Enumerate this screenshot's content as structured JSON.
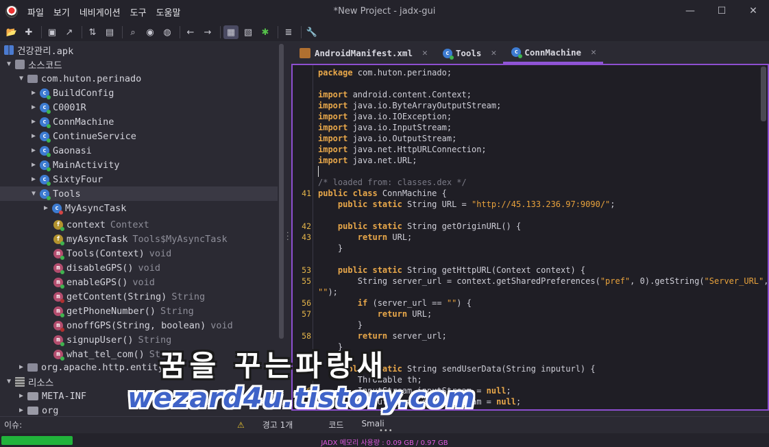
{
  "window": {
    "title": "*New Project - jadx-gui",
    "minimize": "—",
    "maximize": "☐",
    "close": "✕"
  },
  "menu": [
    "파일",
    "보기",
    "네비게이션",
    "도구",
    "도움말"
  ],
  "toolbar": {
    "icons": [
      "open-file-icon",
      "add-file-icon",
      "save-icon",
      "export-icon",
      "sync-icon",
      "flatten-packages-icon",
      "search-icon",
      "find-usage-icon",
      "deobfuscation-icon",
      "back-icon",
      "forward-icon",
      "quark-icon",
      "logcat-icon",
      "debug-icon",
      "log-icon",
      "preferences-icon"
    ]
  },
  "tree": {
    "apk": "건강관리.apk",
    "source_root": "소스코드",
    "package": "com.huton.perinado",
    "classes": [
      "BuildConfig",
      "C0001R",
      "ConnMachine",
      "ContinueService",
      "Gaonasi",
      "MainActivity",
      "SixtyFour",
      "Tools"
    ],
    "tools_children": {
      "inner_class": "MyAsyncTask",
      "fields": [
        {
          "name": "context",
          "type": "Context"
        },
        {
          "name": "myAsyncTask",
          "type": "Tools$MyAsyncTask"
        }
      ],
      "methods": [
        {
          "name": "Tools(Context)",
          "type": "void"
        },
        {
          "name": "disableGPS()",
          "type": "void"
        },
        {
          "name": "enableGPS()",
          "type": "void"
        },
        {
          "name": "getContent(String)",
          "type": "String"
        },
        {
          "name": "getPhoneNumber()",
          "type": "String"
        },
        {
          "name": "onoffGPS(String, boolean)",
          "type": "void"
        },
        {
          "name": "signupUser()",
          "type": "String"
        },
        {
          "name": "what_tel_com()",
          "type": "String"
        }
      ]
    },
    "other_package": "org.apache.http.entity",
    "resources_root": "리소스",
    "resources": [
      "META-INF",
      "org"
    ]
  },
  "tabs": [
    {
      "label": "AndroidManifest.xml",
      "icon": "xml-file-icon"
    },
    {
      "label": "Tools",
      "icon": "class-icon"
    },
    {
      "label": "ConnMachine",
      "icon": "class-icon",
      "active": true
    }
  ],
  "code": {
    "lines": [
      {
        "ln": "",
        "segs": [
          [
            "kw",
            "package"
          ],
          [
            "t",
            " com.huton.perinado;"
          ]
        ]
      },
      {
        "ln": "",
        "segs": []
      },
      {
        "ln": "",
        "segs": [
          [
            "kw",
            "import"
          ],
          [
            "t",
            " android.content.Context;"
          ]
        ]
      },
      {
        "ln": "",
        "segs": [
          [
            "kw",
            "import"
          ],
          [
            "t",
            " java.io.ByteArrayOutputStream;"
          ]
        ]
      },
      {
        "ln": "",
        "segs": [
          [
            "kw",
            "import"
          ],
          [
            "t",
            " java.io.IOException;"
          ]
        ]
      },
      {
        "ln": "",
        "segs": [
          [
            "kw",
            "import"
          ],
          [
            "t",
            " java.io.InputStream;"
          ]
        ]
      },
      {
        "ln": "",
        "segs": [
          [
            "kw",
            "import"
          ],
          [
            "t",
            " java.io.OutputStream;"
          ]
        ]
      },
      {
        "ln": "",
        "segs": [
          [
            "kw",
            "import"
          ],
          [
            "t",
            " java.net.HttpURLConnection;"
          ]
        ]
      },
      {
        "ln": "",
        "segs": [
          [
            "kw",
            "import"
          ],
          [
            "t",
            " java.net.URL;"
          ]
        ]
      },
      {
        "ln": "",
        "segs": [],
        "caret": true
      },
      {
        "ln": "",
        "segs": [
          [
            "cm",
            "/* loaded from: classes.dex */"
          ]
        ]
      },
      {
        "ln": "41",
        "segs": [
          [
            "kw",
            "public class"
          ],
          [
            "t",
            " ConnMachine {"
          ]
        ]
      },
      {
        "ln": "",
        "segs": [
          [
            "t",
            "    "
          ],
          [
            "kw",
            "public static"
          ],
          [
            "t",
            " String URL = "
          ],
          [
            "str",
            "\"http://45.133.236.97:9090/\""
          ],
          [
            "t",
            ";"
          ]
        ]
      },
      {
        "ln": "",
        "segs": []
      },
      {
        "ln": "42",
        "segs": [
          [
            "t",
            "    "
          ],
          [
            "kw",
            "public static"
          ],
          [
            "t",
            " String getOriginURL() {"
          ]
        ]
      },
      {
        "ln": "43",
        "segs": [
          [
            "t",
            "        "
          ],
          [
            "kw",
            "return"
          ],
          [
            "t",
            " URL;"
          ]
        ]
      },
      {
        "ln": "",
        "segs": [
          [
            "t",
            "    }"
          ]
        ]
      },
      {
        "ln": "",
        "segs": []
      },
      {
        "ln": "53",
        "segs": [
          [
            "t",
            "    "
          ],
          [
            "kw",
            "public static"
          ],
          [
            "t",
            " String getHttpURL(Context context) {"
          ]
        ]
      },
      {
        "ln": "55",
        "segs": [
          [
            "t",
            "        String server_url = context.getSharedPreferences("
          ],
          [
            "str",
            "\"pref\""
          ],
          [
            "t",
            ", 0).getString("
          ],
          [
            "str",
            "\"Server_URL\""
          ],
          [
            "t",
            ","
          ]
        ]
      },
      {
        "ln": "",
        "segs": [
          [
            "str",
            "\"\""
          ],
          [
            "t",
            ");"
          ]
        ]
      },
      {
        "ln": "56",
        "segs": [
          [
            "t",
            "        "
          ],
          [
            "kw",
            "if"
          ],
          [
            "t",
            " (server_url == "
          ],
          [
            "str",
            "\"\""
          ],
          [
            "t",
            ") {"
          ]
        ]
      },
      {
        "ln": "57",
        "segs": [
          [
            "t",
            "            "
          ],
          [
            "kw",
            "return"
          ],
          [
            "t",
            " URL;"
          ]
        ]
      },
      {
        "ln": "",
        "segs": [
          [
            "t",
            "        }"
          ]
        ]
      },
      {
        "ln": "58",
        "segs": [
          [
            "t",
            "        "
          ],
          [
            "kw",
            "return"
          ],
          [
            "t",
            " server_url;"
          ]
        ]
      },
      {
        "ln": "",
        "segs": [
          [
            "t",
            "    }"
          ]
        ]
      },
      {
        "ln": "",
        "segs": []
      },
      {
        "ln": "",
        "segs": [
          [
            "t",
            "    "
          ],
          [
            "kw",
            "public static"
          ],
          [
            "t",
            " String sendUserData(String inputurl) {"
          ]
        ]
      },
      {
        "ln": "",
        "segs": [
          [
            "t",
            "        Throwable th;"
          ]
        ]
      },
      {
        "ln": "176",
        "segs": [
          [
            "t",
            "        InputStream inputStream = "
          ],
          [
            "kw",
            "null"
          ],
          [
            "t",
            ";"
          ]
        ]
      },
      {
        "ln": "",
        "segs": [
          [
            "t",
            "        OutputStream outputStream = "
          ],
          [
            "kw",
            "null"
          ],
          [
            "t",
            ";"
          ]
        ]
      }
    ]
  },
  "bottom": {
    "issues_label": "이슈:",
    "warnings": "경고 1개",
    "code_tab": "코드",
    "smali_tab": "Smali",
    "memory": "JADX 메모리 사용량 : 0.09 GB / 0.97 GB",
    "memory_fraction": 0.093
  },
  "watermark": {
    "title": "꿈을 꾸는파랑새",
    "url": "wezard4u.tistory.com"
  },
  "colors": {
    "accent": "#8e4fd1",
    "keyword": "#e9a84a",
    "memory_bar": "#21b33b"
  }
}
